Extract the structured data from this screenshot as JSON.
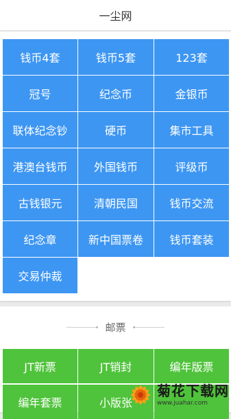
{
  "header": {
    "title": "一尘网"
  },
  "coins": {
    "items": [
      "钱币4套",
      "钱币5套",
      "123套",
      "冠号",
      "纪念币",
      "金银币",
      "联体纪念钞",
      "硬币",
      "集市工具",
      "港澳台钱币",
      "外国钱币",
      "评级币",
      "古钱银元",
      "清朝民国",
      "钱币交流",
      "纪念章",
      "新中国票卷",
      "钱币套装",
      "交易仲裁"
    ]
  },
  "stamps": {
    "title": "邮票",
    "items": [
      "JT新票",
      "JT销封",
      "编年版票",
      "编年套票",
      "小版张",
      ""
    ]
  },
  "watermark": {
    "name": "菊花下载网",
    "url": "www.juahar.com"
  },
  "colors": {
    "coin_tile": "#3d96f2",
    "stamp_tile": "#4fc33b"
  }
}
